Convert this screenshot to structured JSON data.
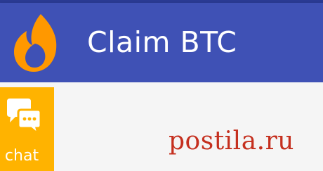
{
  "app_bar": {
    "title": "Claim BTC",
    "logo_icon": "flame-logo-icon",
    "background": "#3f51b5"
  },
  "chat_tab": {
    "label": "chat",
    "icon": "chat-bubbles-icon",
    "background": "#ffb300"
  },
  "watermark": {
    "text": "postila.ru",
    "color": "#c5301f"
  }
}
